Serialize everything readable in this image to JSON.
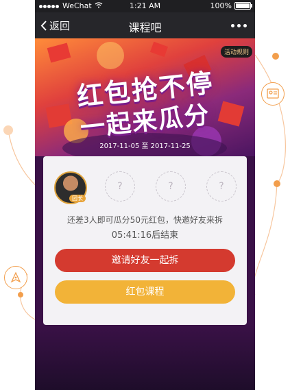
{
  "status_bar": {
    "carrier": "WeChat",
    "time": "1:21 AM",
    "battery": "100%"
  },
  "nav": {
    "back_label": "返回",
    "title": "课程吧"
  },
  "banner": {
    "title_line1": "红包抢不停",
    "title_line2": "一起来瓜分",
    "date_range": "2017-11-05 至 2017-11-25",
    "rules_label": "活动规则"
  },
  "card": {
    "leader_badge": "团长",
    "empty_slot": "?",
    "message": "还差3人即可瓜分50元红包，快邀好友来拆",
    "countdown": "05:41:16后结束",
    "invite_button": "邀请好友一起拆",
    "course_button": "红包课程"
  },
  "icons": {
    "accent": "#f29e4c",
    "invite_color": "#d43a2f",
    "course_color": "#f2b338"
  }
}
